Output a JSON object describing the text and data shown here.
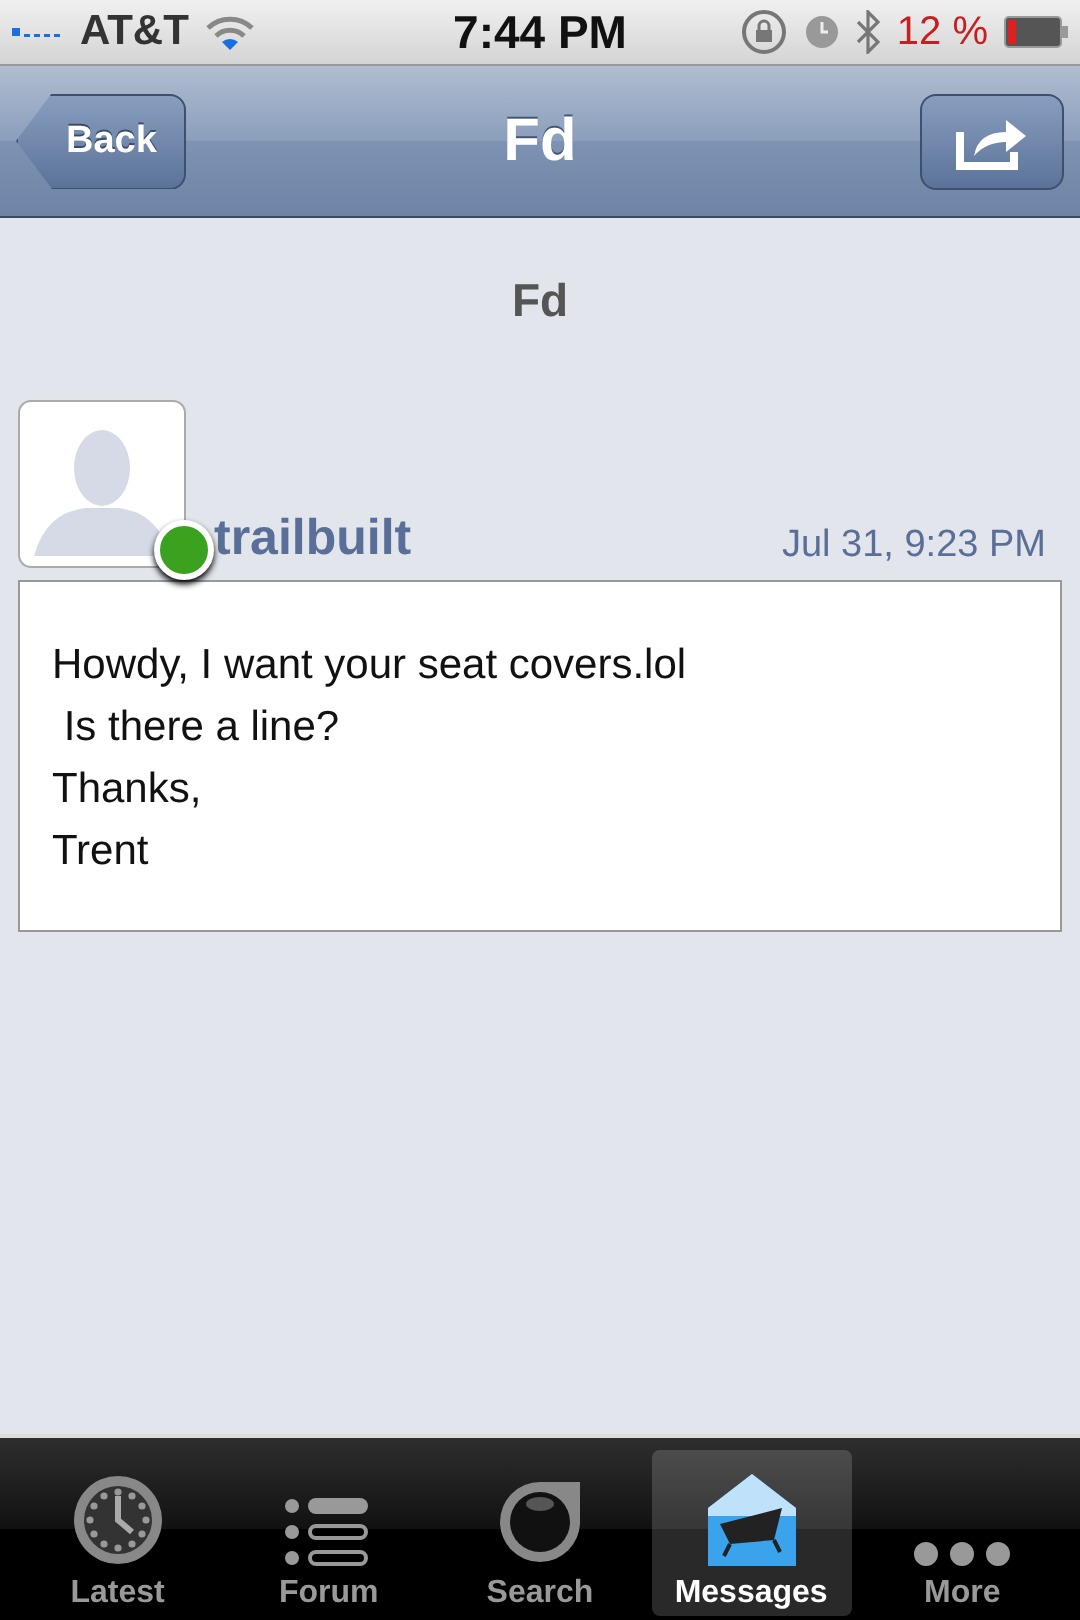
{
  "status_bar": {
    "carrier": "AT&T",
    "time": "7:44 PM",
    "battery_text": "12 %"
  },
  "nav_bar": {
    "back": "Back",
    "title": "Fd"
  },
  "thread_title": "Fd",
  "post": {
    "author": "trailbuilt",
    "online": true,
    "date": "Jul 31, 9:23 PM",
    "body": "Howdy, I want your seat covers.lol\n Is there a line?\nThanks,\nTrent"
  },
  "tab_bar": [
    {
      "label": "Latest",
      "kind": "clock",
      "selected": false
    },
    {
      "label": "Forum",
      "kind": "list",
      "selected": false
    },
    {
      "label": "Search",
      "kind": "search",
      "selected": false
    },
    {
      "label": "Messages",
      "kind": "envelope",
      "selected": true
    },
    {
      "label": "More",
      "kind": "more",
      "selected": false
    }
  ]
}
